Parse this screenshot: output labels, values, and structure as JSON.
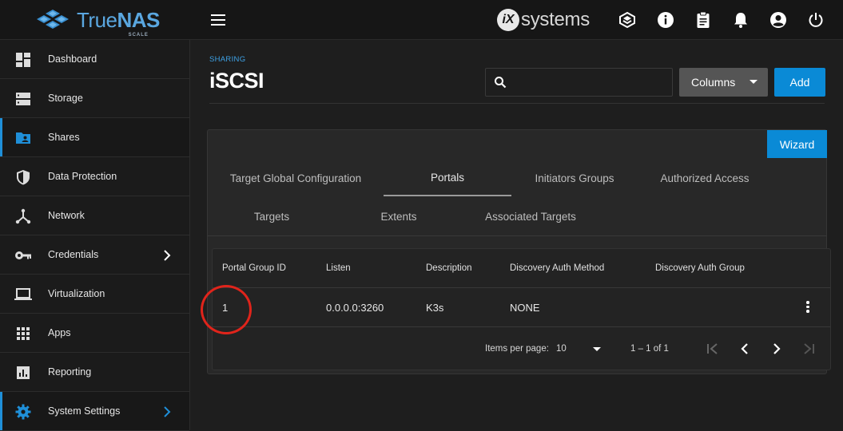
{
  "brand": {
    "name_prefix": "True",
    "name_suffix": "NAS",
    "edition": "SCALE"
  },
  "vendor": {
    "mark": "iX",
    "name": "systems"
  },
  "sidebar": {
    "items": [
      {
        "label": "Dashboard",
        "icon": "dashboard-icon"
      },
      {
        "label": "Storage",
        "icon": "storage-icon"
      },
      {
        "label": "Shares",
        "icon": "folder-shared-icon",
        "active": true
      },
      {
        "label": "Data Protection",
        "icon": "shield-icon"
      },
      {
        "label": "Network",
        "icon": "network-icon"
      },
      {
        "label": "Credentials",
        "icon": "key-icon",
        "has_submenu": true
      },
      {
        "label": "Virtualization",
        "icon": "laptop-icon"
      },
      {
        "label": "Apps",
        "icon": "apps-grid-icon"
      },
      {
        "label": "Reporting",
        "icon": "reporting-icon"
      },
      {
        "label": "System Settings",
        "icon": "gear-icon",
        "has_submenu": true,
        "active": true
      }
    ]
  },
  "header": {
    "breadcrumb": "SHARING",
    "title": "iSCSI",
    "search_placeholder": "",
    "columns_label": "Columns",
    "add_label": "Add"
  },
  "card": {
    "wizard_label": "Wizard",
    "tabs": [
      "Target Global Configuration",
      "Portals",
      "Initiators Groups",
      "Authorized Access",
      "Targets",
      "Extents",
      "Associated Targets"
    ],
    "active_tab": "Portals"
  },
  "table": {
    "columns": [
      "Portal Group ID",
      "Listen",
      "Description",
      "Discovery Auth Method",
      "Discovery Auth Group"
    ],
    "rows": [
      {
        "portal_group_id": "1",
        "listen": "0.0.0.0:3260",
        "description": "K3s",
        "discovery_auth_method": "NONE",
        "discovery_auth_group": ""
      }
    ]
  },
  "paginator": {
    "items_per_page_label": "Items per page:",
    "items_per_page": "10",
    "range_label": "1 – 1 of 1"
  },
  "colors": {
    "accent": "#0a8ad6",
    "annotation": "#e0241b",
    "background": "#1e1e1e"
  }
}
